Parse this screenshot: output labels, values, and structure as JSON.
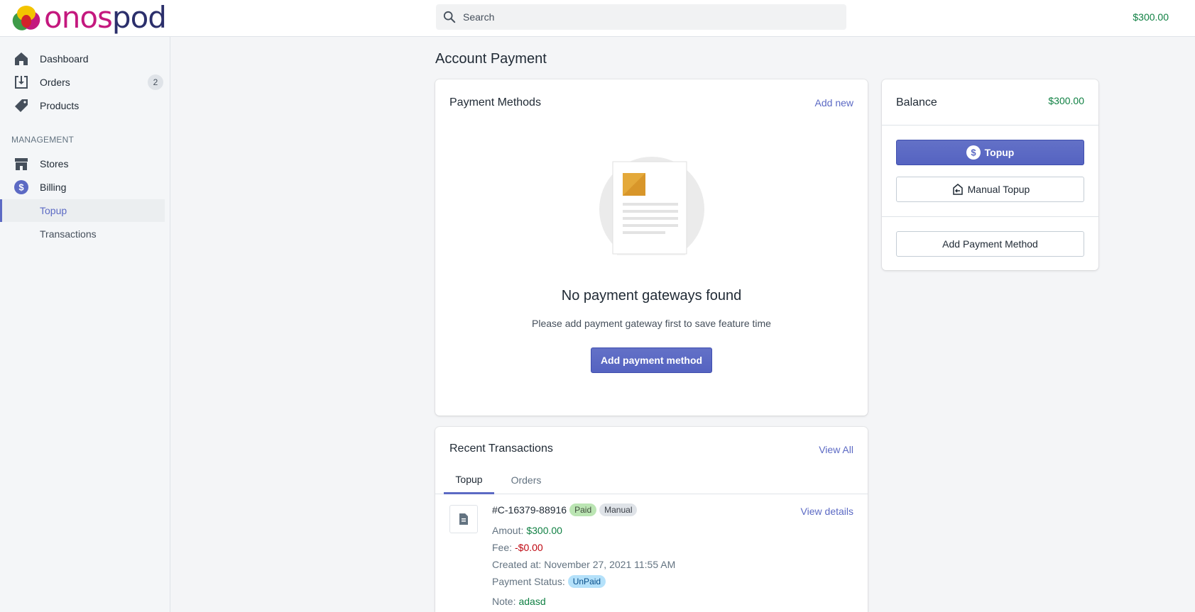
{
  "brand": {
    "name_part1": "onos",
    "name_part2": "pod"
  },
  "header": {
    "search_placeholder": "Search",
    "balance": "$300.00"
  },
  "sidebar": {
    "items": [
      {
        "label": "Dashboard",
        "icon": "home-icon"
      },
      {
        "label": "Orders",
        "icon": "inbox-download-icon",
        "badge": "2"
      },
      {
        "label": "Products",
        "icon": "tag-icon"
      }
    ],
    "section_title": "MANAGEMENT",
    "management": [
      {
        "label": "Stores",
        "icon": "store-icon"
      },
      {
        "label": "Billing",
        "icon": "dollar-circle-icon"
      }
    ],
    "billing_sub": [
      {
        "label": "Topup",
        "active": true
      },
      {
        "label": "Transactions",
        "active": false
      }
    ]
  },
  "page": {
    "title": "Account Payment"
  },
  "payment_methods": {
    "title": "Payment Methods",
    "add_new": "Add new",
    "empty_heading": "No payment gateways found",
    "empty_text": "Please add payment gateway first to save feature time",
    "add_button": "Add payment method"
  },
  "balance": {
    "title": "Balance",
    "amount": "$300.00",
    "topup_button": "Topup",
    "manual_topup_button": "Manual Topup",
    "add_payment_method_button": "Add Payment Method"
  },
  "transactions": {
    "title": "Recent Transactions",
    "view_all": "View All",
    "tabs": [
      {
        "label": "Topup",
        "active": true
      },
      {
        "label": "Orders",
        "active": false
      }
    ],
    "items": [
      {
        "id": "#C-16379-88916",
        "badge_paid": "Paid",
        "badge_manual": "Manual",
        "view_details": "View details",
        "amount_label": "Amout:",
        "amount": "$300.00",
        "fee_label": "Fee:",
        "fee": "-$0.00",
        "created_label": "Created at:",
        "created": "November 27, 2021 11:55 AM",
        "status_label": "Payment Status:",
        "status": "UnPaid",
        "note_label": "Note:",
        "note": "adasd"
      }
    ]
  },
  "colors": {
    "accent": "#5c6ac4",
    "money": "#108043",
    "brand_pink": "#c4187e",
    "brand_navy": "#2b2f6b"
  }
}
